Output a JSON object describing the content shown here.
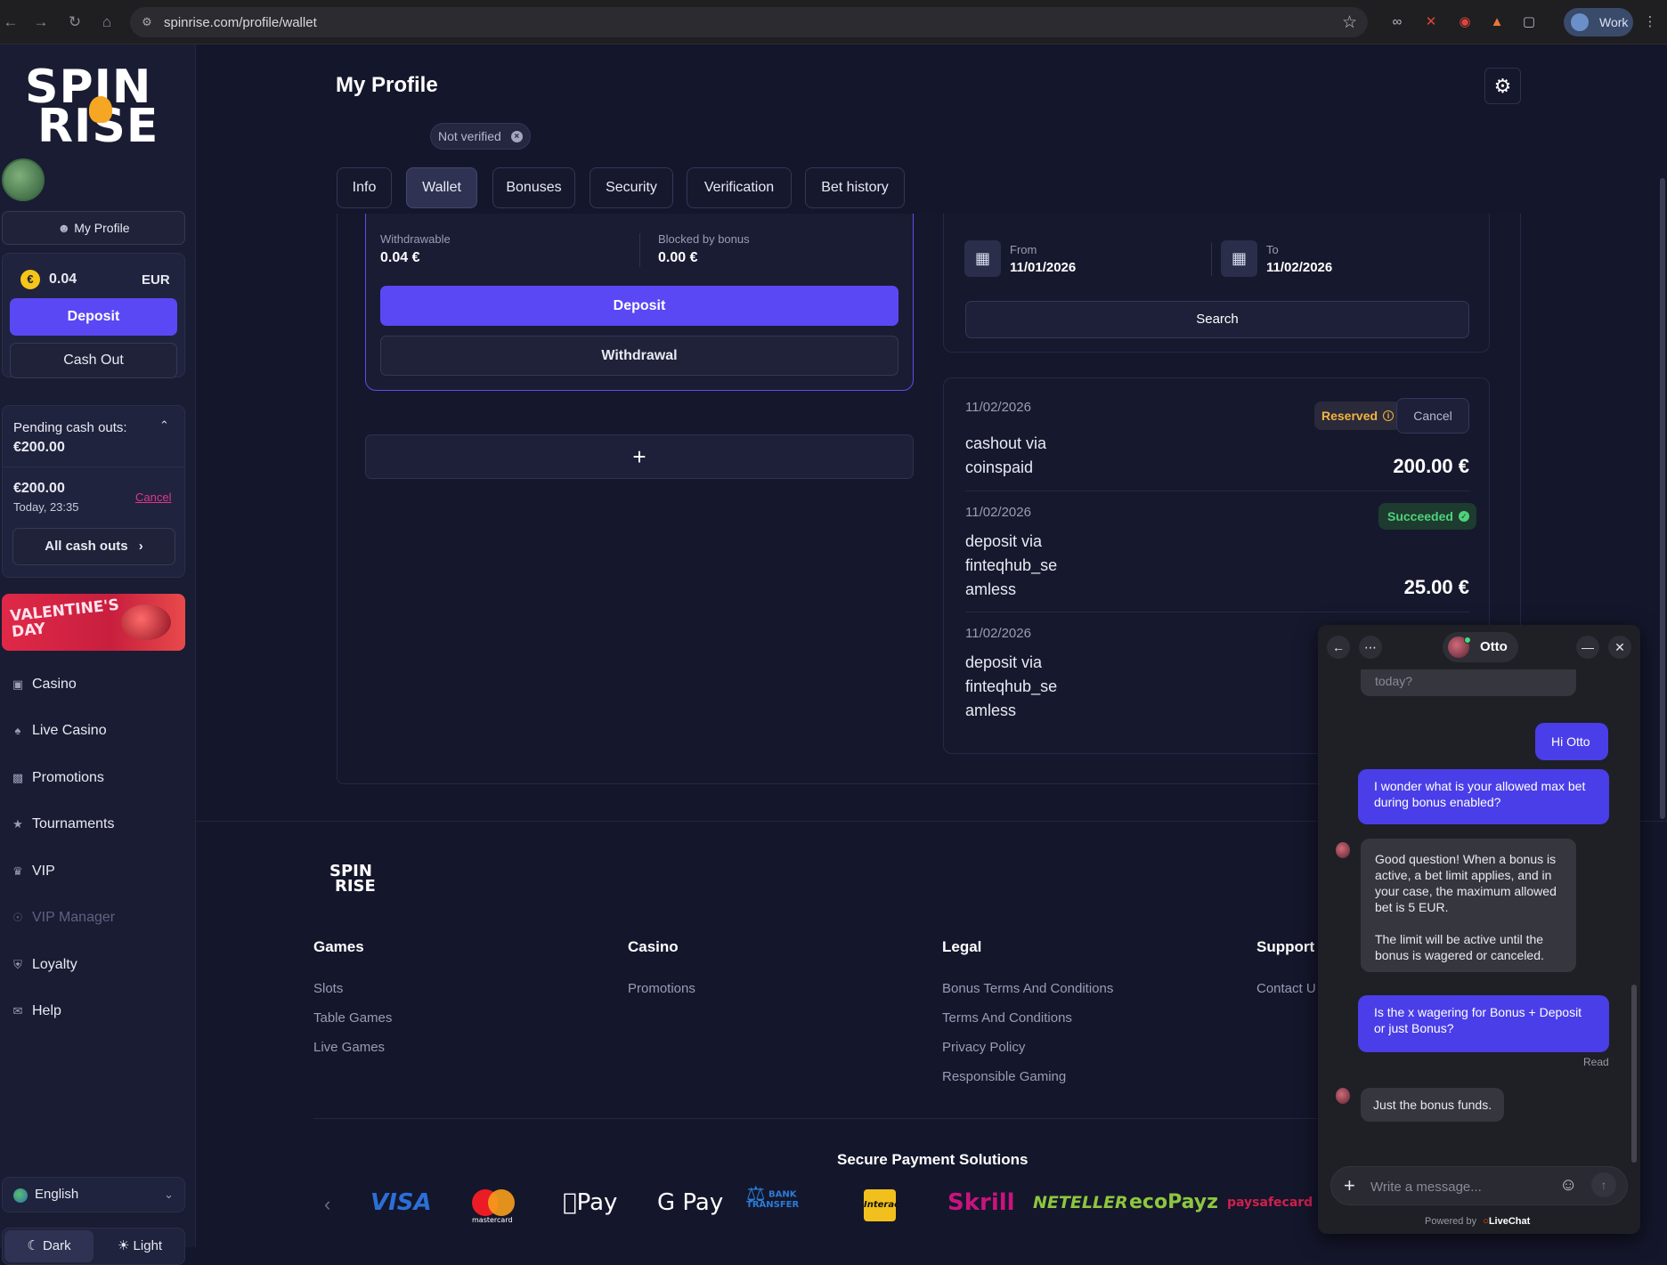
{
  "browser": {
    "url": "spinrise.com/profile/wallet",
    "profile_label": "Work"
  },
  "sidebar": {
    "logo_line1": "SPIN",
    "logo_line2": "RISE",
    "my_profile": "My Profile",
    "balance": "0.04",
    "currency": "EUR",
    "coin_symbol": "€",
    "deposit": "Deposit",
    "cash_out": "Cash Out",
    "pending_title": "Pending cash outs:",
    "pending_total": "€200.00",
    "pending_item_amount": "€200.00",
    "pending_item_time": "Today, 23:35",
    "pending_item_cancel": "Cancel",
    "all_cash_outs": "All cash outs",
    "promo_line1": "VALENTINE'S",
    "promo_line2": "DAY",
    "menu": [
      {
        "label": "Casino",
        "icon": "casino-icon"
      },
      {
        "label": "Live Casino",
        "icon": "live-casino-icon"
      },
      {
        "label": "Promotions",
        "icon": "gift-icon"
      },
      {
        "label": "Tournaments",
        "icon": "trophy-icon"
      },
      {
        "label": "VIP",
        "icon": "crown-icon"
      },
      {
        "label": "VIP Manager",
        "icon": "headset-icon"
      },
      {
        "label": "Loyalty",
        "icon": "shield-icon"
      },
      {
        "label": "Help",
        "icon": "mail-icon"
      }
    ],
    "language": "English",
    "theme_dark": "Dark",
    "theme_light": "Light"
  },
  "main": {
    "title": "My Profile",
    "verification_badge": "Not verified",
    "tabs": [
      "Info",
      "Wallet",
      "Bonuses",
      "Security",
      "Verification",
      "Bet history"
    ],
    "active_tab": "Wallet",
    "wallet": {
      "withdrawable_label": "Withdrawable",
      "withdrawable_value": "0.04 €",
      "blocked_label": "Blocked by bonus",
      "blocked_value": "0.00 €",
      "deposit": "Deposit",
      "withdrawal": "Withdrawal",
      "add_symbol": "+"
    },
    "filter": {
      "from_label": "From",
      "from_value": "11/01/2026",
      "to_label": "To",
      "to_value": "11/02/2026",
      "search": "Search"
    },
    "transactions": [
      {
        "date": "11/02/2026",
        "desc_line1": "cashout via",
        "desc_line2": "coinspaid",
        "desc_line3": "",
        "amount": "200.00 €",
        "status": "Reserved",
        "action": "Cancel"
      },
      {
        "date": "11/02/2026",
        "desc_line1": "deposit via",
        "desc_line2": "finteqhub_se",
        "desc_line3": "amless",
        "amount": "25.00 €",
        "status": "Succeeded"
      },
      {
        "date": "11/02/2026",
        "desc_line1": "deposit via",
        "desc_line2": "finteqhub_se",
        "desc_line3": "amless"
      }
    ]
  },
  "footer": {
    "logo_line1": "SPIN",
    "logo_line2": "RISE",
    "columns": [
      {
        "heading": "Games",
        "links": [
          "Slots",
          "Table Games",
          "Live Games"
        ]
      },
      {
        "heading": "Casino",
        "links": [
          "Promotions"
        ]
      },
      {
        "heading": "Legal",
        "links": [
          "Bonus Terms And Conditions",
          "Terms And Conditions",
          "Privacy Policy",
          "Responsible Gaming"
        ]
      },
      {
        "heading": "Support",
        "links": [
          "Contact U"
        ]
      }
    ],
    "secure_title": "Secure Payment Solutions",
    "payment_logos": [
      "VISA",
      "mastercard",
      "Pay",
      "G Pay",
      "BANK TRANSFER",
      "Interac",
      "Skrill",
      "NETELLER",
      "ecoPayz",
      "paysafecard"
    ]
  },
  "chat": {
    "agent_name": "Otto",
    "messages": [
      {
        "from": "agent",
        "text": "today?"
      },
      {
        "from": "user",
        "text": "Hi Otto"
      },
      {
        "from": "user",
        "text": "I wonder what is your allowed max bet during bonus enabled?"
      },
      {
        "from": "agent",
        "text": "Good question! When a bonus is active, a bet limit applies, and in your case, the maximum allowed bet is 5 EUR."
      },
      {
        "from": "agent",
        "text": "The limit will be active until the bonus is wagered or canceled."
      },
      {
        "from": "user",
        "text": "Is the x wagering for Bonus + Deposit or just Bonus?"
      },
      {
        "from": "agent",
        "text": "Just the bonus funds."
      }
    ],
    "read_receipt": "Read",
    "input_placeholder": "Write a message...",
    "powered_by": "Powered by",
    "brand": "LiveChat"
  },
  "colors": {
    "accent": "#5a48f5",
    "background": "#14162b",
    "sidebar": "#1a1c33",
    "reserved": "#f4b441",
    "succeeded": "#4fd27b",
    "cancel_link": "#e0358e"
  }
}
